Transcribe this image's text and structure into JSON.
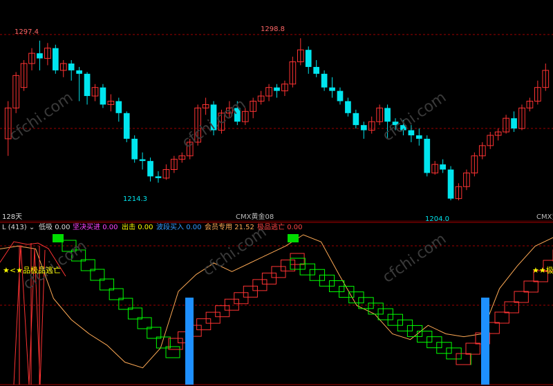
{
  "colors": {
    "up": "#ff3333",
    "down": "#00e5ee",
    "dash": "#a00000",
    "low": "#dddddd",
    "firm": "#ff44ff",
    "out": "#ffff00",
    "wave": "#3399ff",
    "member": "#ffaa55",
    "escape": "#ff4444",
    "grid_green": "#00ff00",
    "signal": "#00dd00",
    "bar": "#1e90ff"
  },
  "main": {
    "high_left": "1297.4",
    "high_mid": "1298.8",
    "low_left": "1214.3",
    "low_right": "1204.0",
    "period": "128天",
    "symbol_mid": "CMX黄金08",
    "symbol_right": "CMX黄"
  },
  "indicator": {
    "name": "L (413)",
    "chevron_icon": "chevron-down-icon",
    "low_label": "低吸",
    "low_value": "0.00",
    "firm_label": "坚决买进",
    "firm_value": "0.00",
    "out_label": "出击",
    "out_value": "0.00",
    "wave_label": "波段买入",
    "wave_value": "0.00",
    "member_label": "会员专用",
    "member_value": "21.52",
    "escape_label": "极品逃亡",
    "escape_value": "0.00",
    "signal_left": "★<★品极品逃亡",
    "signal_right": "★★极"
  },
  "watermark": "cfchi.com",
  "chart_data": {
    "type": "candlestick",
    "price_range": [
      1200,
      1305
    ],
    "candles": [
      [
        1240,
        1258,
        1230,
        1262
      ],
      [
        1258,
        1277,
        1255,
        1279
      ],
      [
        1270,
        1284,
        1268,
        1286
      ],
      [
        1284,
        1290,
        1280,
        1293
      ],
      [
        1290,
        1287,
        1280,
        1297.4
      ],
      [
        1287,
        1293,
        1283,
        1296
      ],
      [
        1293,
        1280,
        1278,
        1295
      ],
      [
        1280,
        1284,
        1276,
        1286
      ],
      [
        1284,
        1280,
        1274,
        1286
      ],
      [
        1280,
        1278,
        1262,
        1282
      ],
      [
        1278,
        1265,
        1260,
        1279
      ],
      [
        1265,
        1270,
        1262,
        1272
      ],
      [
        1270,
        1260,
        1258,
        1272
      ],
      [
        1260,
        1262,
        1256,
        1266
      ],
      [
        1262,
        1255,
        1250,
        1264
      ],
      [
        1255,
        1240,
        1238,
        1256
      ],
      [
        1240,
        1228,
        1226,
        1242
      ],
      [
        1228,
        1227,
        1222,
        1232
      ],
      [
        1227,
        1218,
        1215,
        1229
      ],
      [
        1218,
        1217,
        1214.3,
        1221
      ],
      [
        1217,
        1222,
        1216,
        1225
      ],
      [
        1222,
        1228,
        1220,
        1230
      ],
      [
        1228,
        1230,
        1226,
        1232
      ],
      [
        1230,
        1238,
        1228,
        1240
      ],
      [
        1238,
        1258,
        1236,
        1260
      ],
      [
        1258,
        1260,
        1254,
        1264
      ],
      [
        1260,
        1245,
        1242,
        1262
      ],
      [
        1245,
        1255,
        1243,
        1257
      ],
      [
        1255,
        1258,
        1252,
        1262
      ],
      [
        1258,
        1250,
        1248,
        1262
      ],
      [
        1250,
        1256,
        1248,
        1258
      ],
      [
        1256,
        1262,
        1252,
        1264
      ],
      [
        1262,
        1265,
        1260,
        1268
      ],
      [
        1265,
        1270,
        1262,
        1272
      ],
      [
        1270,
        1268,
        1264,
        1272
      ],
      [
        1268,
        1272,
        1265,
        1274
      ],
      [
        1272,
        1285,
        1270,
        1288
      ],
      [
        1285,
        1292,
        1283,
        1298.8
      ],
      [
        1292,
        1282,
        1278,
        1294
      ],
      [
        1282,
        1278,
        1276,
        1286
      ],
      [
        1278,
        1270,
        1268,
        1280
      ],
      [
        1270,
        1268,
        1264,
        1276
      ],
      [
        1268,
        1262,
        1260,
        1270
      ],
      [
        1262,
        1255,
        1253,
        1264
      ],
      [
        1255,
        1248,
        1246,
        1257
      ],
      [
        1248,
        1245,
        1240,
        1250
      ],
      [
        1245,
        1250,
        1243,
        1253
      ],
      [
        1250,
        1258,
        1248,
        1260
      ],
      [
        1258,
        1250,
        1240,
        1260
      ],
      [
        1250,
        1248,
        1245,
        1252
      ],
      [
        1248,
        1245,
        1242,
        1251
      ],
      [
        1245,
        1242,
        1238,
        1248
      ],
      [
        1242,
        1240,
        1236,
        1246
      ],
      [
        1240,
        1220,
        1218,
        1242
      ],
      [
        1220,
        1225,
        1219,
        1227
      ],
      [
        1225,
        1222,
        1220,
        1228
      ],
      [
        1222,
        1205,
        1204,
        1224
      ],
      [
        1205,
        1212,
        1204,
        1214
      ],
      [
        1212,
        1220,
        1210,
        1222
      ],
      [
        1220,
        1230,
        1218,
        1232
      ],
      [
        1230,
        1236,
        1228,
        1238
      ],
      [
        1236,
        1242,
        1234,
        1244
      ],
      [
        1242,
        1244,
        1239,
        1246
      ],
      [
        1244,
        1252,
        1243,
        1254
      ],
      [
        1252,
        1246,
        1244,
        1256
      ],
      [
        1246,
        1258,
        1245,
        1260
      ],
      [
        1258,
        1262,
        1256,
        1264
      ],
      [
        1262,
        1270,
        1260,
        1274
      ],
      [
        1270,
        1280,
        1268,
        1284
      ]
    ],
    "indicator_lines": {
      "member_curve": [
        0.9,
        0.92,
        0.9,
        0.55,
        0.4,
        0.3,
        0.22,
        0.1,
        0.06,
        0.2,
        0.6,
        0.72,
        0.8,
        0.74,
        0.8,
        0.86,
        0.92,
        1.0,
        0.95,
        0.72,
        0.5,
        0.44,
        0.3,
        0.26,
        0.36,
        0.3,
        0.28,
        0.3,
        0.62,
        0.78,
        0.92,
        0.98
      ]
    }
  }
}
